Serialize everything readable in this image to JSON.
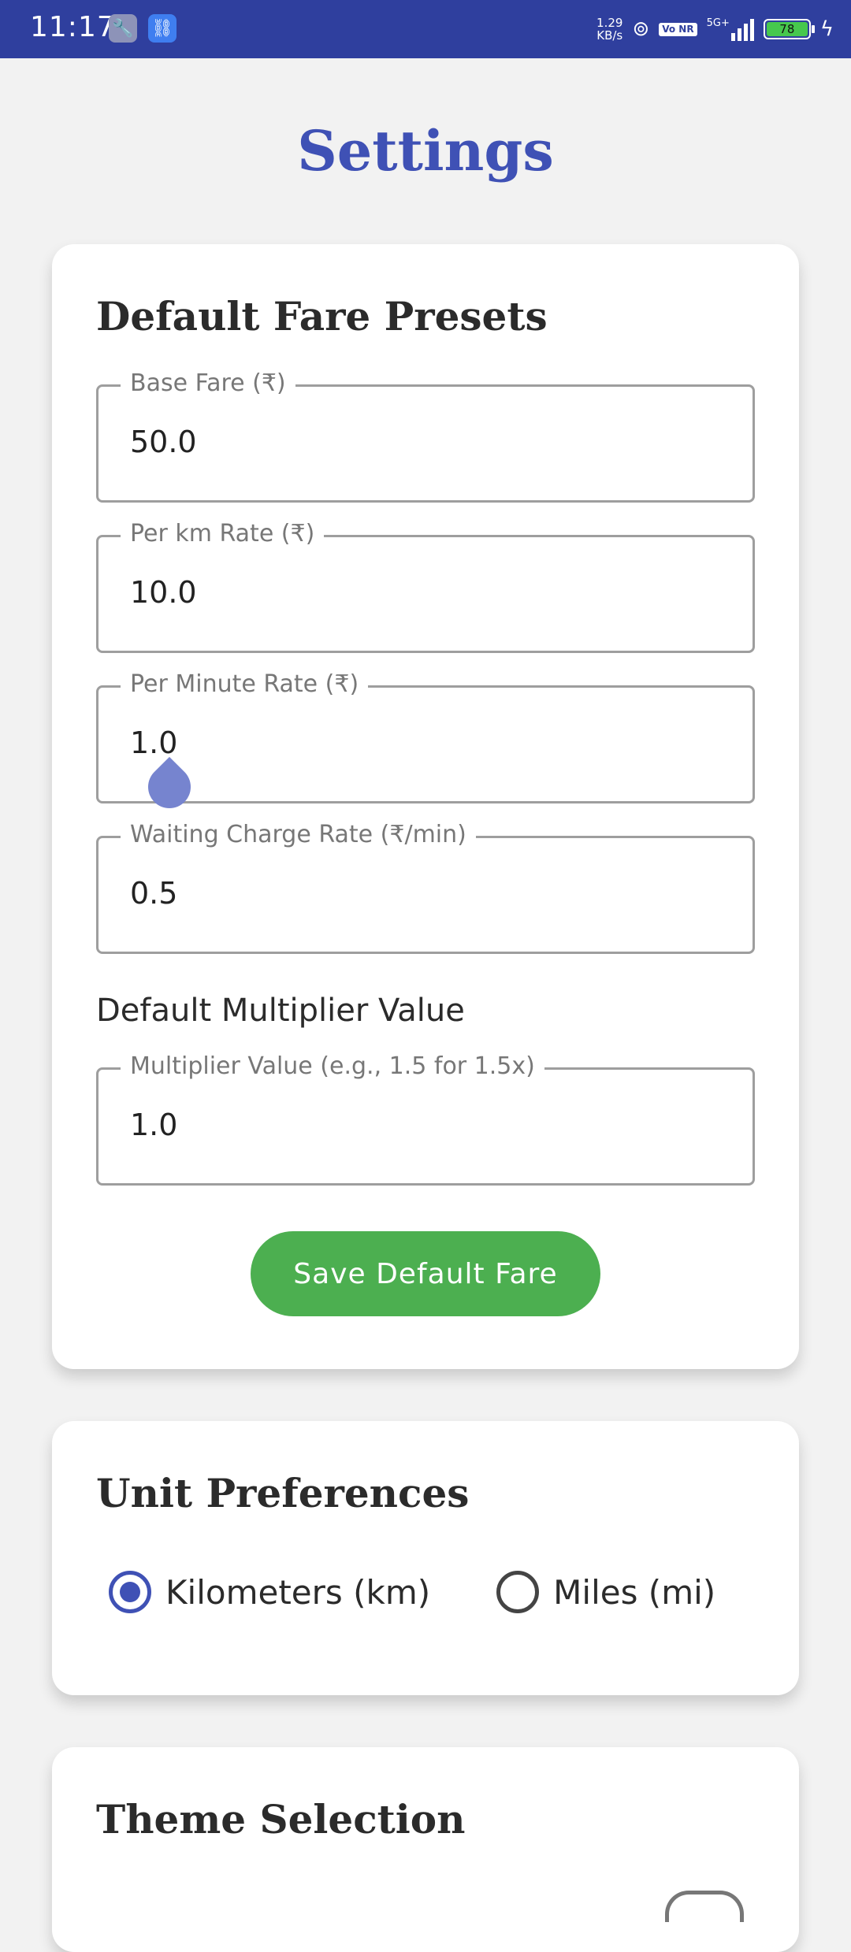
{
  "status_bar": {
    "time": "11:17",
    "speed_value": "1.29",
    "speed_unit": "KB/s",
    "network": "5G+",
    "volte": "Vo NR",
    "battery": "78"
  },
  "page": {
    "title": "Settings"
  },
  "fare_presets": {
    "title": "Default Fare Presets",
    "fields": [
      {
        "label": "Base Fare (₹)",
        "value": "50.0"
      },
      {
        "label": "Per km Rate (₹)",
        "value": "10.0"
      },
      {
        "label": "Per Minute Rate (₹)",
        "value": "1.0"
      },
      {
        "label": "Waiting Charge Rate (₹/min)",
        "value": "0.5"
      }
    ],
    "multiplier_heading": "Default Multiplier Value",
    "multiplier_field": {
      "label": "Multiplier Value (e.g., 1.5 for 1.5x)",
      "value": "1.0"
    },
    "save_label": "Save Default Fare"
  },
  "unit_preferences": {
    "title": "Unit Preferences",
    "options": [
      {
        "label": "Kilometers (km)",
        "checked": true
      },
      {
        "label": "Miles (mi)",
        "checked": false
      }
    ]
  },
  "theme_selection": {
    "title": "Theme Selection"
  },
  "colors": {
    "primary": "#3f51b5",
    "status_bar": "#2f3f9e",
    "save_button": "#4caf50"
  }
}
